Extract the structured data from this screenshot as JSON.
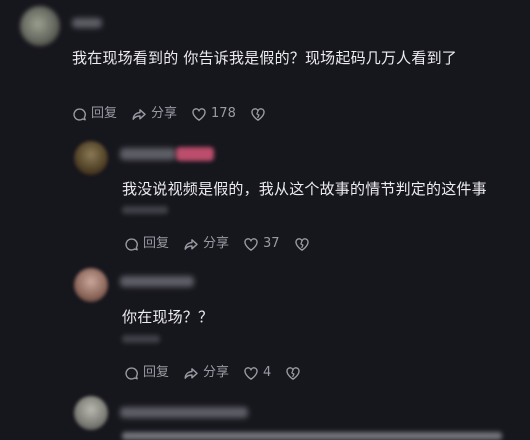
{
  "comments": [
    {
      "text": "我在现场看到的 你告诉我是假的？现场起码几万人看到了",
      "reply_label": "回复",
      "share_label": "分享",
      "like_count": "178"
    },
    {
      "text": "我没说视频是假的，我从这个故事的情节判定的这件事",
      "reply_label": "回复",
      "share_label": "分享",
      "like_count": "37"
    },
    {
      "text": "你在现场？？",
      "reply_label": "回复",
      "share_label": "分享",
      "like_count": "4"
    }
  ],
  "colors": {
    "background": "#16161d",
    "text": "#ececf0",
    "muted": "#9a9aa3",
    "badge_pink": "#d9577a"
  },
  "icons": [
    "reply-icon",
    "share-icon",
    "heart-icon",
    "broken-heart-icon"
  ]
}
